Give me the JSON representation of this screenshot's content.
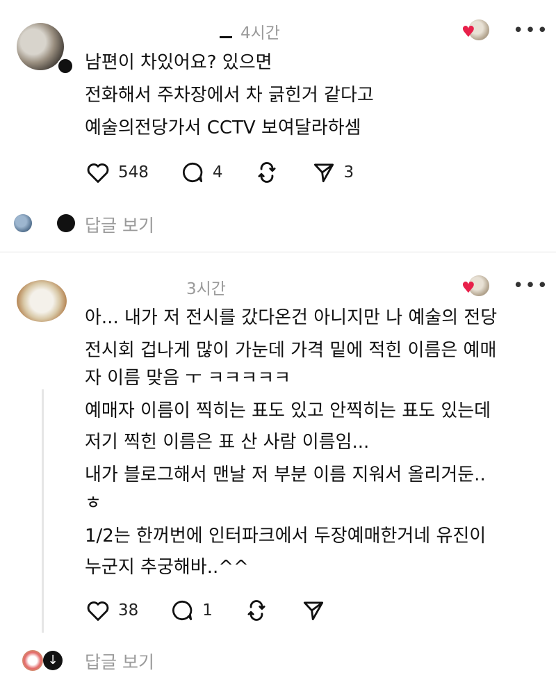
{
  "posts": [
    {
      "time": "4시간",
      "lines": [
        "남편이 차있어요? 있으면",
        "전화해서 주차장에서 차 긁힌거 같다고",
        "예술의전당가서 CCTV 보여달라하셈"
      ],
      "likes": "548",
      "comments": "4",
      "shares": "3",
      "reply_label": "답글 보기"
    },
    {
      "time": "3시간",
      "lines": [
        "아... 내가 저 전시를 갔다온건 아니지만 나 예술의 전당",
        "전시회 겁나게 많이 가눈데 가격 밑에 적힌 이름은 예매",
        "자 이름 맞음 ㅜ ㅋㅋㅋㅋㅋ",
        "예매자 이름이 찍히는 표도 있고 안찍히는 표도 있는데",
        "저기 찍힌 이름은 표 산 사람 이름임...",
        "내가 블로그해서 맨날 저 부분 이름 지워서 올리거둔..",
        "ㅎ",
        "1/2는 한꺼번에 인터파크에서 두장예매한거네 유진이",
        "누군지 추궁해바..^^"
      ],
      "likes": "38",
      "comments": "1",
      "reply_label": "답글 보기"
    }
  ],
  "icons": {
    "like": "heart-icon",
    "comment": "comment-icon",
    "repost": "repost-icon",
    "share": "send-icon",
    "more": "more-icon"
  },
  "colors": {
    "liked_heart": "#e8204a",
    "muted_text": "#9a9a9a",
    "divider": "#e2e2e2"
  }
}
